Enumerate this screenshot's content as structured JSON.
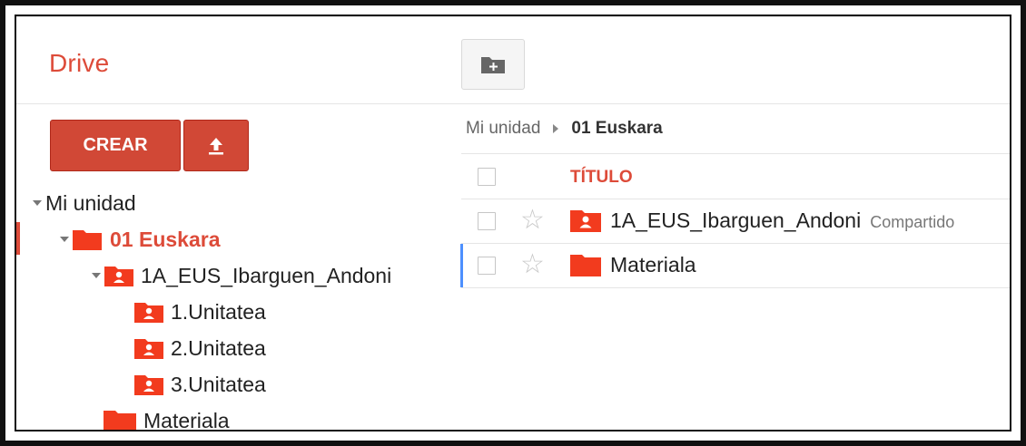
{
  "header": {
    "app_name": "Drive",
    "new_folder_icon": "folder-plus-icon"
  },
  "sidebar": {
    "create_label": "CREAR",
    "upload_icon": "upload-arrow-icon",
    "tree": [
      {
        "label": "Mi unidad",
        "depth": 0,
        "expanded": true,
        "icon": "none"
      },
      {
        "label": "01 Euskara",
        "depth": 1,
        "expanded": true,
        "icon": "folder-icon",
        "active": true
      },
      {
        "label": "1A_EUS_Ibarguen_Andoni",
        "depth": 2,
        "expanded": true,
        "icon": "shared-folder-icon"
      },
      {
        "label": "1.Unitatea",
        "depth": 3,
        "icon": "shared-folder-icon"
      },
      {
        "label": "2.Unitatea",
        "depth": 3,
        "icon": "shared-folder-icon"
      },
      {
        "label": "3.Unitatea",
        "depth": 3,
        "icon": "shared-folder-icon"
      },
      {
        "label": "Materiala",
        "depth": 2,
        "icon": "folder-icon"
      }
    ]
  },
  "breadcrumb": {
    "root": "Mi unidad",
    "current": "01 Euskara"
  },
  "list": {
    "title_header": "TÍTULO",
    "rows": [
      {
        "name": "1A_EUS_Ibarguen_Andoni",
        "tag": "Compartido",
        "icon": "shared-folder-icon",
        "starred": false
      },
      {
        "name": "Materiala",
        "tag": "",
        "icon": "folder-icon",
        "starred": false,
        "focused": true
      }
    ]
  },
  "colors": {
    "accent_red": "#dd4b39",
    "button_red": "#d14836",
    "folder_red": "#f23b1e",
    "focus_blue": "#4d90fe"
  }
}
